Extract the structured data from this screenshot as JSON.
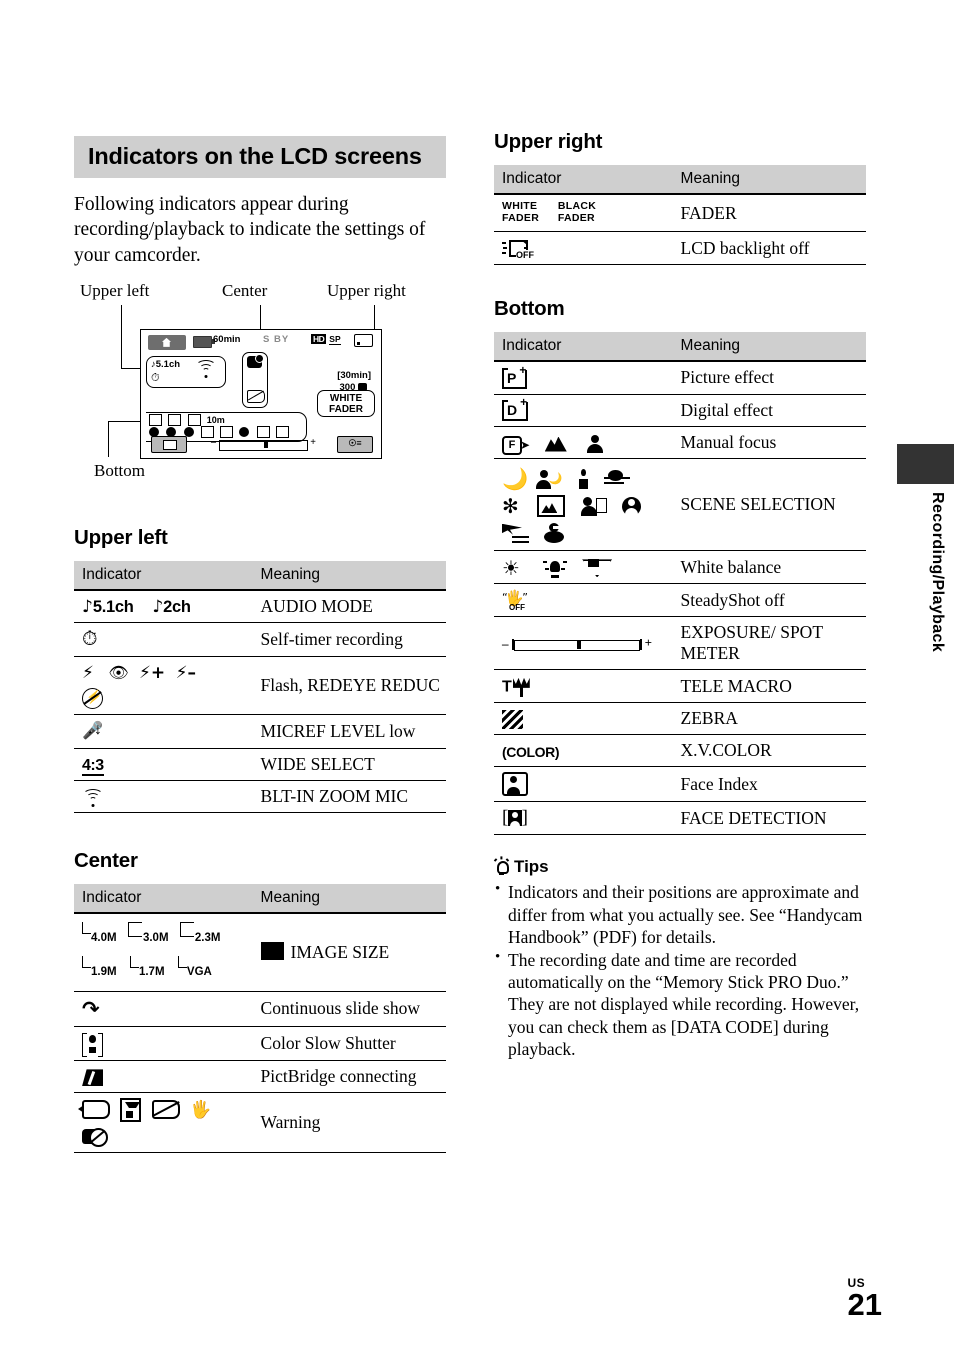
{
  "header": {
    "title": "Indicators on the LCD screens",
    "intro": "Following indicators appear during recording/playback to indicate the settings of your camcorder."
  },
  "diagram": {
    "label_upper_left": "Upper left",
    "label_center": "Center",
    "label_upper_right": "Upper right",
    "label_bottom": "Bottom",
    "lcd": {
      "battery_time": "60min",
      "standby": "S  BY",
      "quality_hd": "HD",
      "quality_sp": "SP",
      "audio_mode": "5.1ch",
      "remaining_time": "[30min]",
      "still_count": "300",
      "fader_label_line1": "WHITE",
      "fader_label_line2": "FADER",
      "focus_distance": "10m",
      "option_button": "OPTION"
    }
  },
  "sections": {
    "upper_left": {
      "title": "Upper left",
      "columns": [
        "Indicator",
        "Meaning"
      ],
      "rows": [
        {
          "meaning": "AUDIO MODE",
          "icon_names": [
            "audio-5-1ch-icon",
            "audio-2ch-icon"
          ],
          "icon_text": [
            "5.1ch",
            "2ch"
          ]
        },
        {
          "meaning": "Self-timer recording",
          "icon_names": [
            "self-timer-icon"
          ],
          "icon_text": []
        },
        {
          "meaning": "Flash, REDEYE REDUC",
          "icon_names": [
            "flash-icon",
            "redeye-icon",
            "flash-plus-icon",
            "flash-minus-icon",
            "flash-off-icon"
          ],
          "icon_text": []
        },
        {
          "meaning": "MICREF LEVEL low",
          "icon_names": [
            "micref-level-low-icon"
          ],
          "icon_text": []
        },
        {
          "meaning": "WIDE SELECT",
          "icon_names": [
            "wide-select-4-3-icon"
          ],
          "icon_text": [
            "4:3"
          ]
        },
        {
          "meaning": "BLT-IN ZOOM MIC",
          "icon_names": [
            "built-in-zoom-mic-icon"
          ],
          "icon_text": []
        }
      ]
    },
    "center": {
      "title": "Center",
      "columns": [
        "Indicator",
        "Meaning"
      ],
      "rows": [
        {
          "meaning": "IMAGE SIZE",
          "icon_names": [
            "image-size-icon"
          ],
          "icon_text": [
            "4.0M",
            "3.0M",
            "2.3M",
            "1.9M",
            "1.7M",
            "VGA"
          ]
        },
        {
          "meaning": "Continuous slide show",
          "icon_names": [
            "slide-show-loop-icon"
          ],
          "icon_text": []
        },
        {
          "meaning": "Color Slow Shutter",
          "icon_names": [
            "color-slow-shutter-icon"
          ],
          "icon_text": []
        },
        {
          "meaning": "PictBridge connecting",
          "icon_names": [
            "pictbridge-icon"
          ],
          "icon_text": []
        },
        {
          "meaning": "Warning",
          "icon_names": [
            "warning-tape-icon",
            "warning-battery-icon",
            "warning-no-card-icon",
            "warning-shake-icon",
            "warning-drop-icon"
          ],
          "icon_text": []
        }
      ]
    },
    "upper_right": {
      "title": "Upper right",
      "columns": [
        "Indicator",
        "Meaning"
      ],
      "rows": [
        {
          "meaning": "FADER",
          "icon_names": [
            "white-fader-icon",
            "black-fader-icon"
          ],
          "icon_text": [
            "WHITE",
            "FADER",
            "BLACK",
            "FADER"
          ]
        },
        {
          "meaning": "LCD backlight off",
          "icon_names": [
            "lcd-backlight-off-icon"
          ],
          "icon_text": [
            "OFF"
          ]
        }
      ]
    },
    "bottom": {
      "title": "Bottom",
      "columns": [
        "Indicator",
        "Meaning"
      ],
      "rows": [
        {
          "meaning": "Picture effect",
          "icon_names": [
            "picture-effect-icon"
          ],
          "icon_text": [
            "P"
          ]
        },
        {
          "meaning": "Digital effect",
          "icon_names": [
            "digital-effect-icon"
          ],
          "icon_text": [
            "D"
          ]
        },
        {
          "meaning": "Manual focus",
          "icon_names": [
            "manual-focus-icon",
            "mountain-focus-icon",
            "person-focus-icon"
          ],
          "icon_text": [
            "F"
          ]
        },
        {
          "meaning": "SCENE SELECTION",
          "icon_names": [
            "twilight-icon",
            "twilight-portrait-icon",
            "candle-icon",
            "sunrise-sunset-icon",
            "fireworks-icon",
            "landscape-icon",
            "portrait-icon",
            "spotlight-icon",
            "beach-icon",
            "snow-icon"
          ],
          "icon_text": []
        },
        {
          "meaning": "White balance",
          "icon_names": [
            "white-balance-outdoor-icon",
            "white-balance-indoor-icon",
            "white-balance-one-push-icon"
          ],
          "icon_text": []
        },
        {
          "meaning": "SteadyShot off",
          "icon_names": [
            "steadyshot-off-icon"
          ],
          "icon_text": [
            "OFF"
          ]
        },
        {
          "meaning": "EXPOSURE/ SPOT METER",
          "icon_names": [
            "exposure-slider-icon"
          ],
          "icon_text": []
        },
        {
          "meaning": "TELE MACRO",
          "icon_names": [
            "tele-macro-icon"
          ],
          "icon_text": [
            "T"
          ]
        },
        {
          "meaning": "ZEBRA",
          "icon_names": [
            "zebra-icon"
          ],
          "icon_text": []
        },
        {
          "meaning": "X.V.COLOR",
          "icon_names": [
            "xv-color-icon"
          ],
          "icon_text": [
            "(COLOR)"
          ]
        },
        {
          "meaning": "Face Index",
          "icon_names": [
            "face-index-icon"
          ],
          "icon_text": []
        },
        {
          "meaning": "FACE DETECTION",
          "icon_names": [
            "face-detection-icon"
          ],
          "icon_text": []
        }
      ]
    }
  },
  "tips": {
    "heading": "Tips",
    "items": [
      "Indicators and their positions are approximate and differ from what you actually see. See “Handycam Handbook” (PDF) for details.",
      "The recording date and time are recorded automatically on the “Memory Stick PRO Duo.” They are not displayed while recording. However, you can check them as [DATA CODE] during playback."
    ]
  },
  "side_tab": {
    "label": "Recording/Playback"
  },
  "folio": {
    "region": "US",
    "page": "21"
  }
}
